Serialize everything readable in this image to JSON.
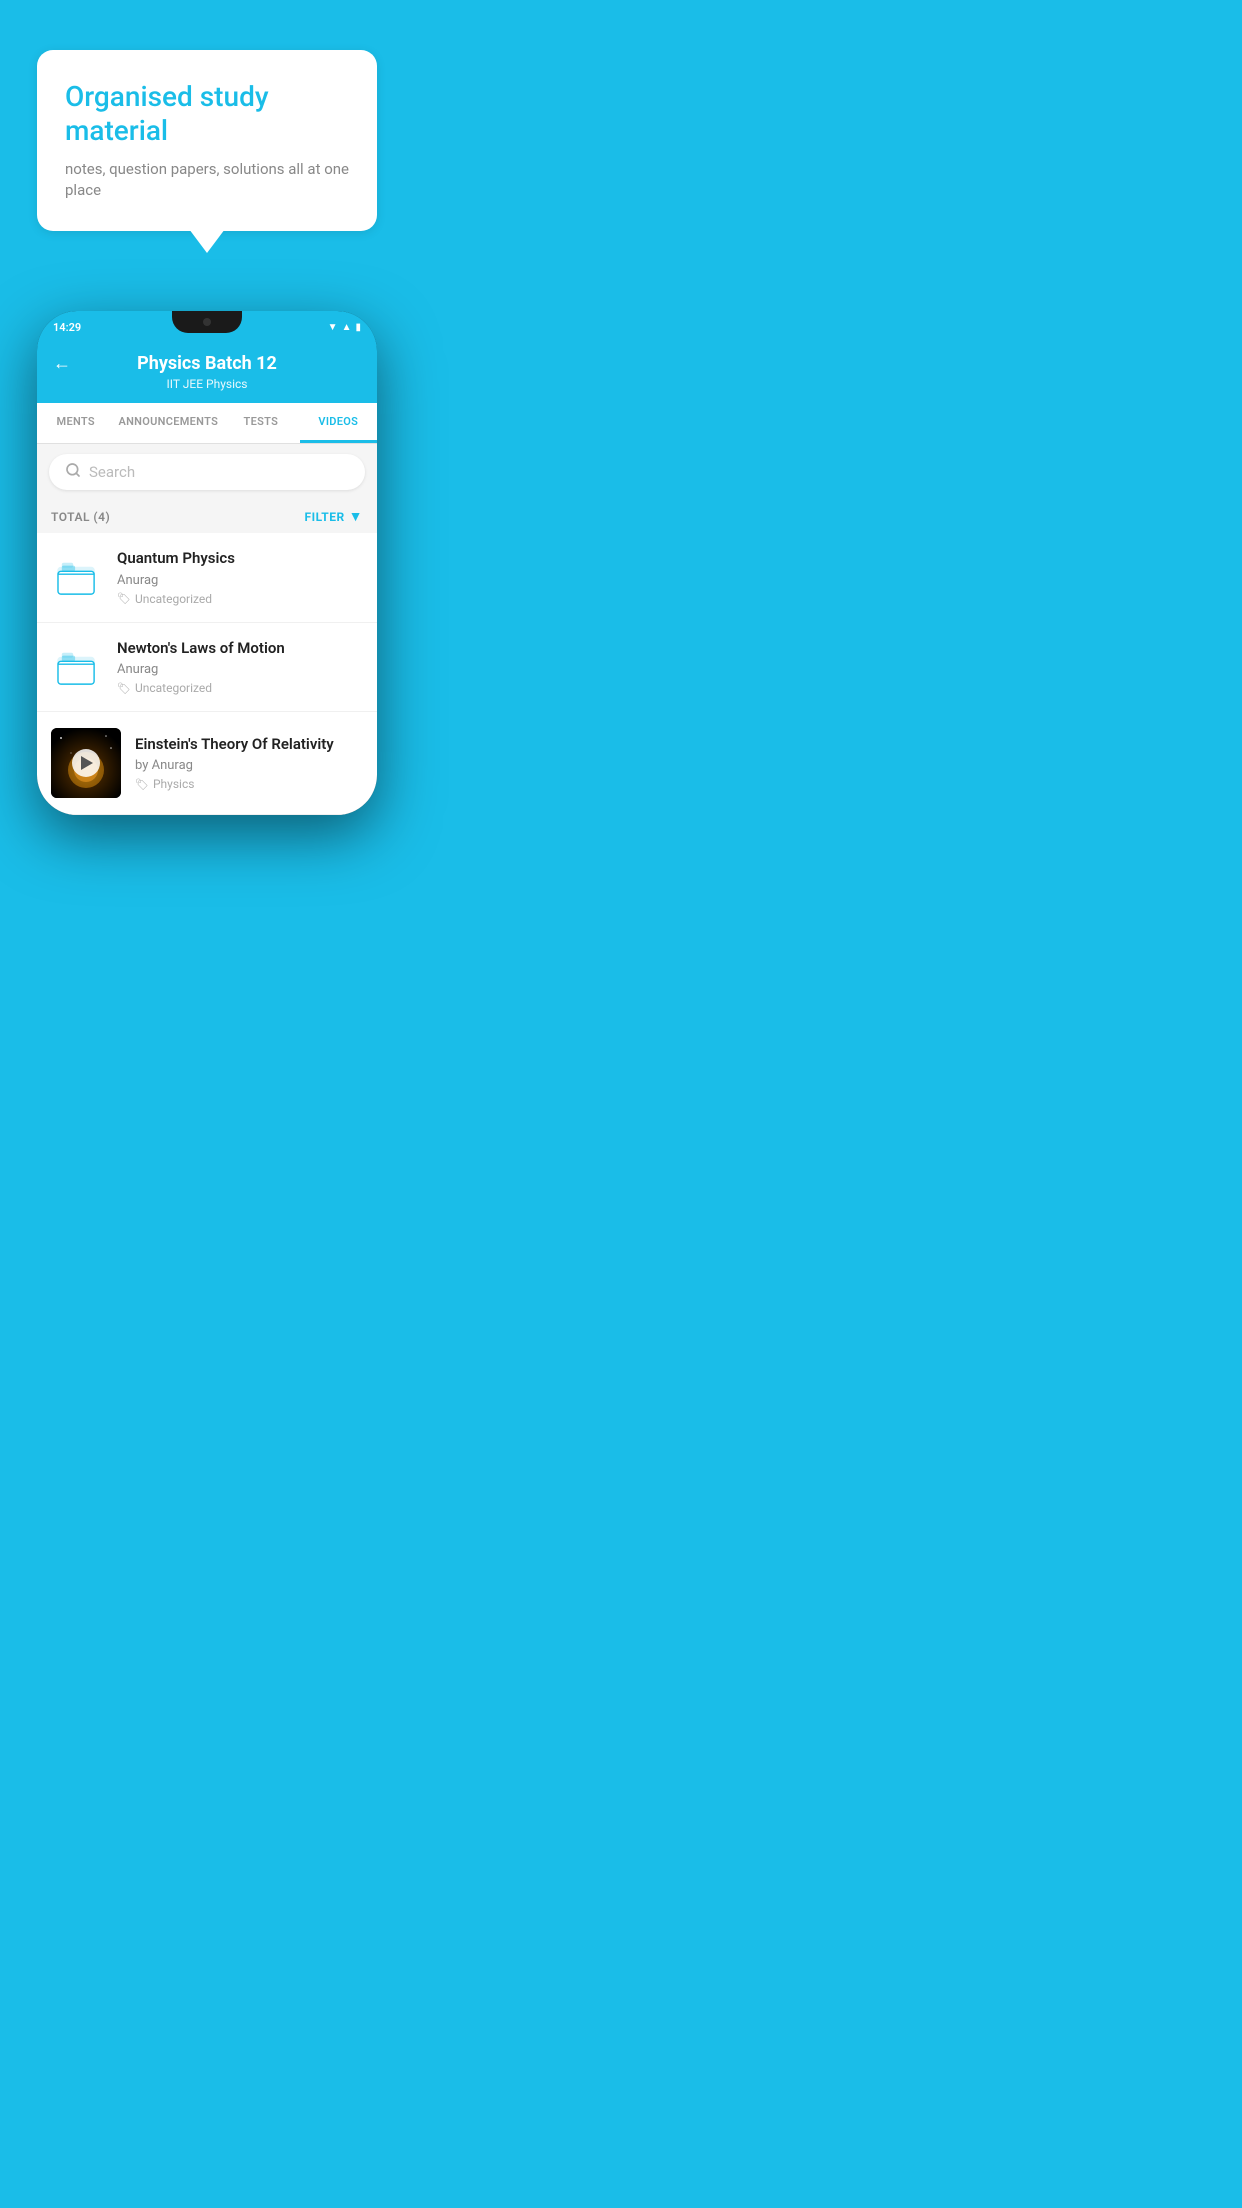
{
  "background": {
    "color": "#1ABDE8"
  },
  "speech_bubble": {
    "title": "Organised study material",
    "subtitle": "notes, question papers, solutions all at one place"
  },
  "phone": {
    "status_bar": {
      "time": "14:29"
    },
    "header": {
      "title": "Physics Batch 12",
      "subtitle": "IIT JEE   Physics",
      "back_label": "←"
    },
    "tabs": [
      {
        "label": "MENTS",
        "active": false
      },
      {
        "label": "ANNOUNCEMENTS",
        "active": false
      },
      {
        "label": "TESTS",
        "active": false
      },
      {
        "label": "VIDEOS",
        "active": true
      }
    ],
    "search": {
      "placeholder": "Search"
    },
    "filter_row": {
      "total_label": "TOTAL (4)",
      "filter_label": "FILTER"
    },
    "videos": [
      {
        "id": "1",
        "title": "Quantum Physics",
        "author": "Anurag",
        "tag": "Uncategorized",
        "has_thumbnail": false
      },
      {
        "id": "2",
        "title": "Newton's Laws of Motion",
        "author": "Anurag",
        "tag": "Uncategorized",
        "has_thumbnail": false
      },
      {
        "id": "3",
        "title": "Einstein's Theory Of Relativity",
        "author": "by Anurag",
        "tag": "Physics",
        "has_thumbnail": true
      }
    ]
  }
}
